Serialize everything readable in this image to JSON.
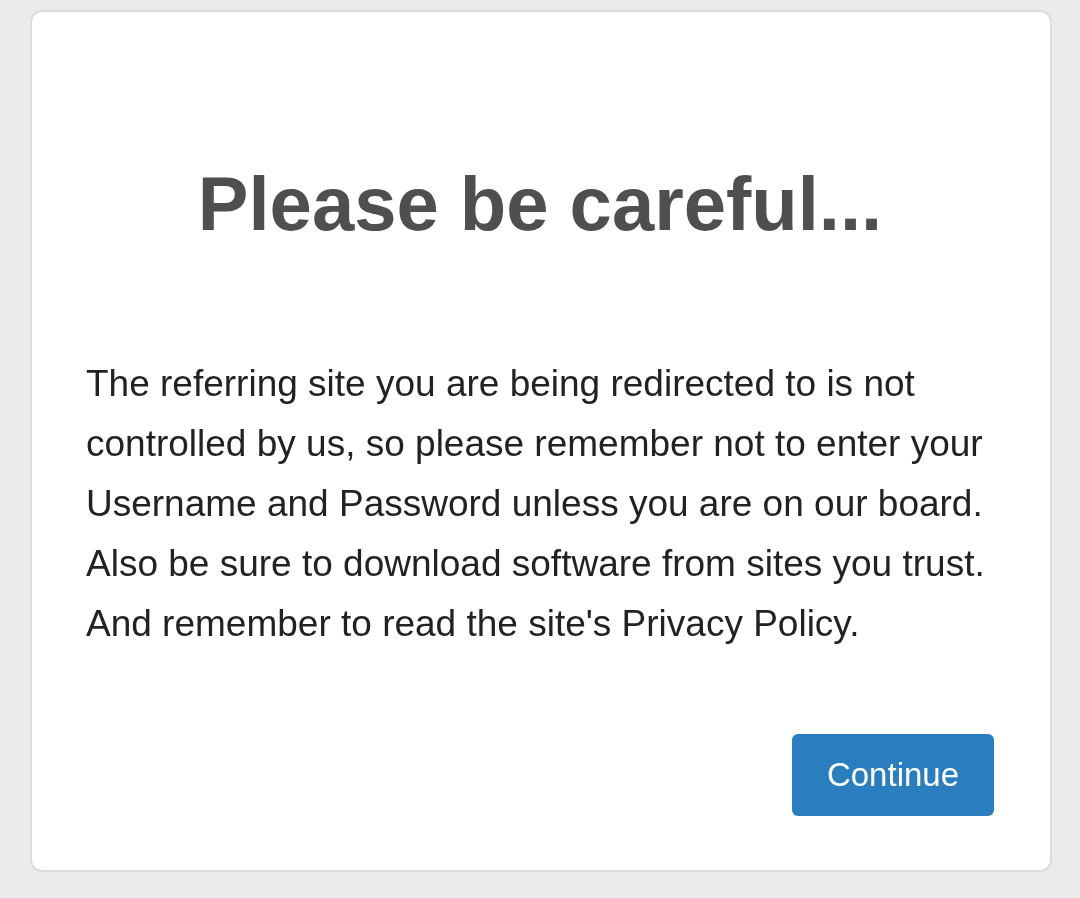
{
  "dialog": {
    "title": "Please be careful...",
    "message": "The referring site you are being redirected to is not controlled by us, so please remember not to enter your Username and Password unless you are on our board. Also be sure to download software from sites you trust. And remember to read the site's Privacy Policy.",
    "buttons": [
      {
        "label": "Continue",
        "kind": "primary"
      }
    ]
  }
}
